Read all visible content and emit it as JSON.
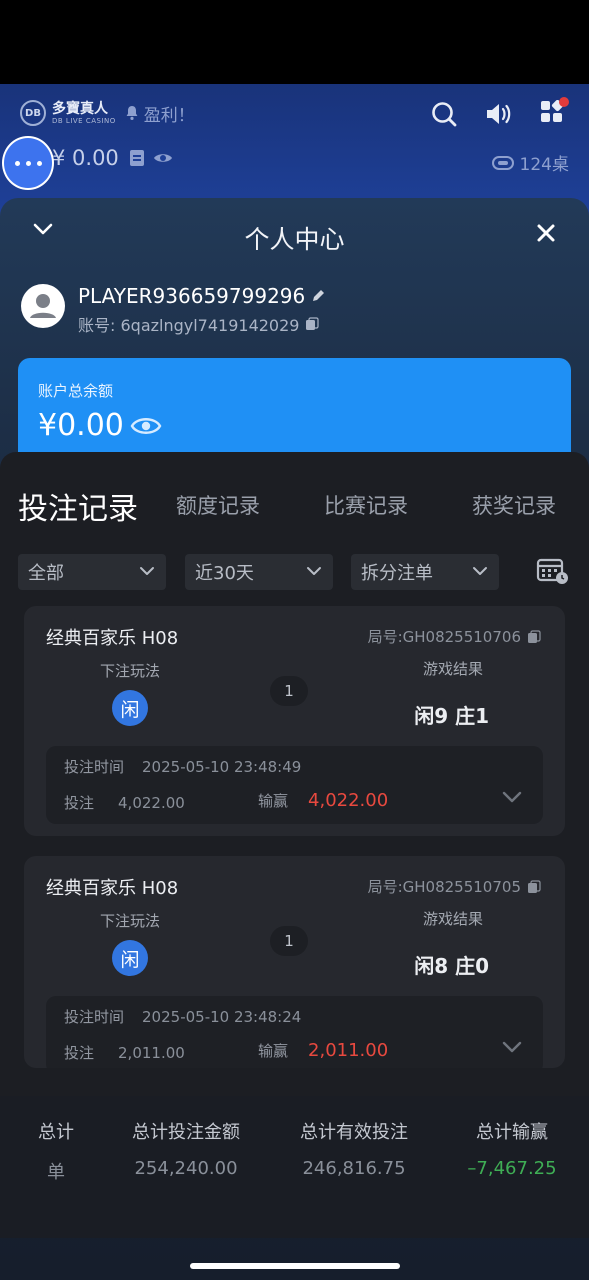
{
  "header": {
    "logo_text": "多寶真人",
    "logo_sub": "DB LIVE CASINO",
    "marquee": "盈利！",
    "balance": "¥ 0.00",
    "table_count": "124桌",
    "icons": [
      "search-icon",
      "volume-icon",
      "apps-icon"
    ]
  },
  "sheet": {
    "title": "个人中心",
    "player_name": "PLAYER936659799296",
    "account_label": "账号: 6qazlngyl7419142029",
    "wallet_label": "账户总余额",
    "wallet_amount": "¥0.00"
  },
  "records": {
    "tabs": [
      {
        "label": "投注记录",
        "active": true
      },
      {
        "label": "额度记录",
        "active": false
      },
      {
        "label": "比赛记录",
        "active": false
      },
      {
        "label": "获奖记录",
        "active": false
      }
    ],
    "filters": [
      "全部",
      "近30天",
      "拆分注单"
    ],
    "labels": {
      "bet_type": "下注玩法",
      "result": "游戏结果",
      "bet_time": "投注时间",
      "bet": "投注",
      "win_loss": "输赢"
    },
    "cards": [
      {
        "game": "经典百家乐 H08",
        "round": "局号:GH0825510706",
        "chip": "闲",
        "count": "1",
        "result": "闲9 庄1",
        "time": "2025-05-10 23:48:49",
        "bet": "4,022.00",
        "win": "4,022.00"
      },
      {
        "game": "经典百家乐 H08",
        "round": "局号:GH0825510705",
        "chip": "闲",
        "count": "1",
        "result": "闲8 庄0",
        "time": "2025-05-10 23:48:24",
        "bet": "2,011.00",
        "win": "2,011.00"
      }
    ]
  },
  "summary": {
    "total_label": "总计",
    "unit_label": "单",
    "bet_amount_label": "总计投注金额",
    "bet_amount": "254,240.00",
    "valid_bet_label": "总计有效投注",
    "valid_bet": "246,816.75",
    "win_loss_label": "总计输赢",
    "win_loss": "–7,467.25"
  },
  "colors": {
    "accent": "#3d86f5",
    "wallet": "#1f90f5",
    "win": "#e8493f",
    "loss": "#3fae55"
  }
}
